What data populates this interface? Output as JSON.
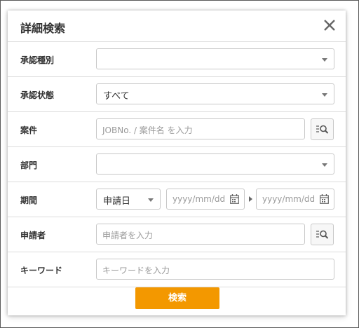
{
  "dialog": {
    "title": "詳細検索",
    "close_icon": "close-icon"
  },
  "fields": {
    "approval_type": {
      "label": "承認種別",
      "value": ""
    },
    "approval_status": {
      "label": "承認状態",
      "value": "すべて"
    },
    "project": {
      "label": "案件",
      "placeholder": "JOBNo. / 案件名 を入力",
      "lookup_icon": "list-search-icon"
    },
    "department": {
      "label": "部門",
      "value": ""
    },
    "period": {
      "label": "期間",
      "type_value": "申請日",
      "from_placeholder": "yyyy/mm/dd",
      "to_placeholder": "yyyy/mm/dd",
      "calendar_icon": "calendar-icon"
    },
    "applicant": {
      "label": "申請者",
      "placeholder": "申請者を入力",
      "lookup_icon": "list-search-icon"
    },
    "keyword": {
      "label": "キーワード",
      "placeholder": "キーワードを入力"
    }
  },
  "actions": {
    "search_label": "検索"
  },
  "colors": {
    "accent": "#f39800",
    "border": "#c8c8c8",
    "divider": "#dcdcdc"
  }
}
